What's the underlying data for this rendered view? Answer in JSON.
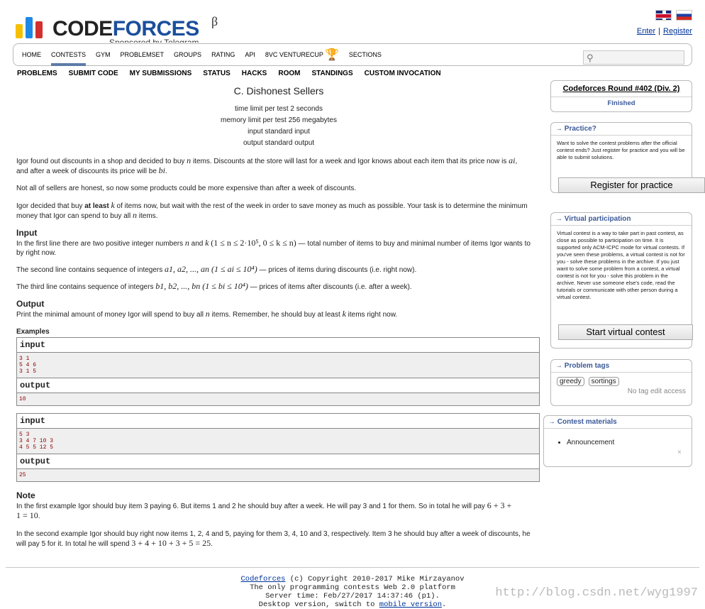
{
  "header": {
    "logo_word_a": "CODE",
    "logo_word_b": "FORCES",
    "beta": "β",
    "sponsor": "Sponsored by Telegram",
    "enter": "Enter",
    "separator": "|",
    "register": "Register",
    "bar_colors": [
      "#f6c000",
      "#1e88e5",
      "#d32f2f"
    ],
    "brand_colors": {
      "code": "#222222",
      "forces": "#1b4f9c"
    }
  },
  "menu": {
    "items": [
      "HOME",
      "CONTESTS",
      "GYM",
      "PROBLEMSET",
      "GROUPS",
      "RATING",
      "API",
      "8VC VENTURECUP",
      "SECTIONS"
    ],
    "active": "CONTESTS"
  },
  "submenu": [
    "PROBLEMS",
    "SUBMIT CODE",
    "MY SUBMISSIONS",
    "STATUS",
    "HACKS",
    "ROOM",
    "STANDINGS",
    "CUSTOM INVOCATION"
  ],
  "problem": {
    "title": "C. Dishonest Sellers",
    "time_limit": "time limit per test 2 seconds",
    "memory_limit": "memory limit per test 256 megabytes",
    "input": "input standard input",
    "output": "output standard output",
    "statement_1a": "Igor found out discounts in a shop and decided to buy ",
    "statement_1b": " items. Discounts at the store will last for a week and Igor knows about each item that its price now is ",
    "statement_1c": ", and after a week of discounts its price will be ",
    "statement_2": "Not all of sellers are honest, so now some products could be more expensive than after a week of discounts.",
    "statement_3a": "Igor decided that buy ",
    "statement_3b": "at least",
    "statement_3c": " of items now, but wait with the rest of the week in order to save money as much as possible. Your task is to determine the minimum money that Igor can spend to buy all ",
    "statement_3d": " items.",
    "input_title": "Input",
    "input_1a": "In the first line there are two positive integer numbers ",
    "input_1b": " and ",
    "input_1c": " — total number of items to buy and minimal number of items Igor wants to by right now.",
    "input_2a": "The second line contains sequence of integers ",
    "input_2b": " — prices of items during discounts (i.e. right now).",
    "input_3a": "The third line contains sequence of integers ",
    "input_3b": " — prices of items after discounts (i.e. after a week).",
    "output_title": "Output",
    "output_1a": "Print the minimal amount of money Igor will spend to buy all ",
    "output_1b": " items. Remember, he should buy at least ",
    "output_1c": " items right now.",
    "examples_title": "Examples",
    "input_label": "input",
    "output_label": "output",
    "example1_input": "3 1\n5 4 6\n3 1 5",
    "example1_output": "10",
    "example2_input": "5 3\n3 4 7 10 3\n4 5 5 12 5",
    "example2_output": "25",
    "note_title": "Note",
    "note_1a": "In the first example Igor should buy item 3 paying 6. But items 1 and 2 he should buy after a week. He will pay 3 and 1 for them. So in total he will pay ",
    "note_1b": "6 + 3 + 1 = 10",
    "note_2a": "In the second example Igor should buy right now items 1, 2, 4 and 5, paying for them 3, 4, 10 and 3, respectively. Item 3 he should buy after a week of discounts, he will pay 5 for it. In total he will spend ",
    "note_2b": "3 + 4 + 10 + 3 + 5 = 25",
    "math_n": "n",
    "math_k": "k",
    "math_ai": "ai",
    "math_bi": "bi",
    "math_nk": "(1 ≤ n ≤ 2·10⁵, 0 ≤ k ≤ n)",
    "math_a": "a1, a2, ..., an (1 ≤ ai ≤ 10⁴)",
    "math_b": "b1, b2, ..., bn (1 ≤ bi ≤ 10⁴)"
  },
  "sidebar": {
    "round_title": "Codeforces Round #402 (Div. 2)",
    "round_status": "Finished",
    "practice_title": "→ Practice?",
    "practice_text": "Want to solve the contest problems after the official contest ends? Just register for practice and you will be able to submit solutions.",
    "practice_button": "Register for practice",
    "virtual_title": "→ Virtual participation",
    "virtual_text": "Virtual contest is a way to take part in past contest, as close as possible to participation on time. It is supported only ACM-ICPC mode for virtual contests. If you've seen these problems, a virtual contest is not for you - solve these problems in the archive. If you just want to solve some problem from a contest, a virtual contest is not for you - solve this problem in the archive. Never use someone else's code, read the tutorials or communicate with other person during a virtual contest.",
    "virtual_button": "Start virtual contest",
    "tags_title": "→ Problem tags",
    "tags": [
      "greedy",
      "sortings"
    ],
    "no_tag_edit": "No tag edit access",
    "materials_title": "→ Contest materials",
    "materials": [
      "Announcement"
    ],
    "close_mark": "×"
  },
  "footer": {
    "line1_link": "Codeforces",
    "line1_rest": " (c) Copyright 2010-2017 Mike Mirzayanov",
    "line2": "The only programming contests Web 2.0 platform",
    "line3": "Server time: Feb/27/2017 14:37:46 (p1).",
    "line4_a": "Desktop version, switch to ",
    "line4_link": "mobile version",
    "line4_b": ".",
    "watermark": "http://blog.csdn.net/wyg1997"
  }
}
